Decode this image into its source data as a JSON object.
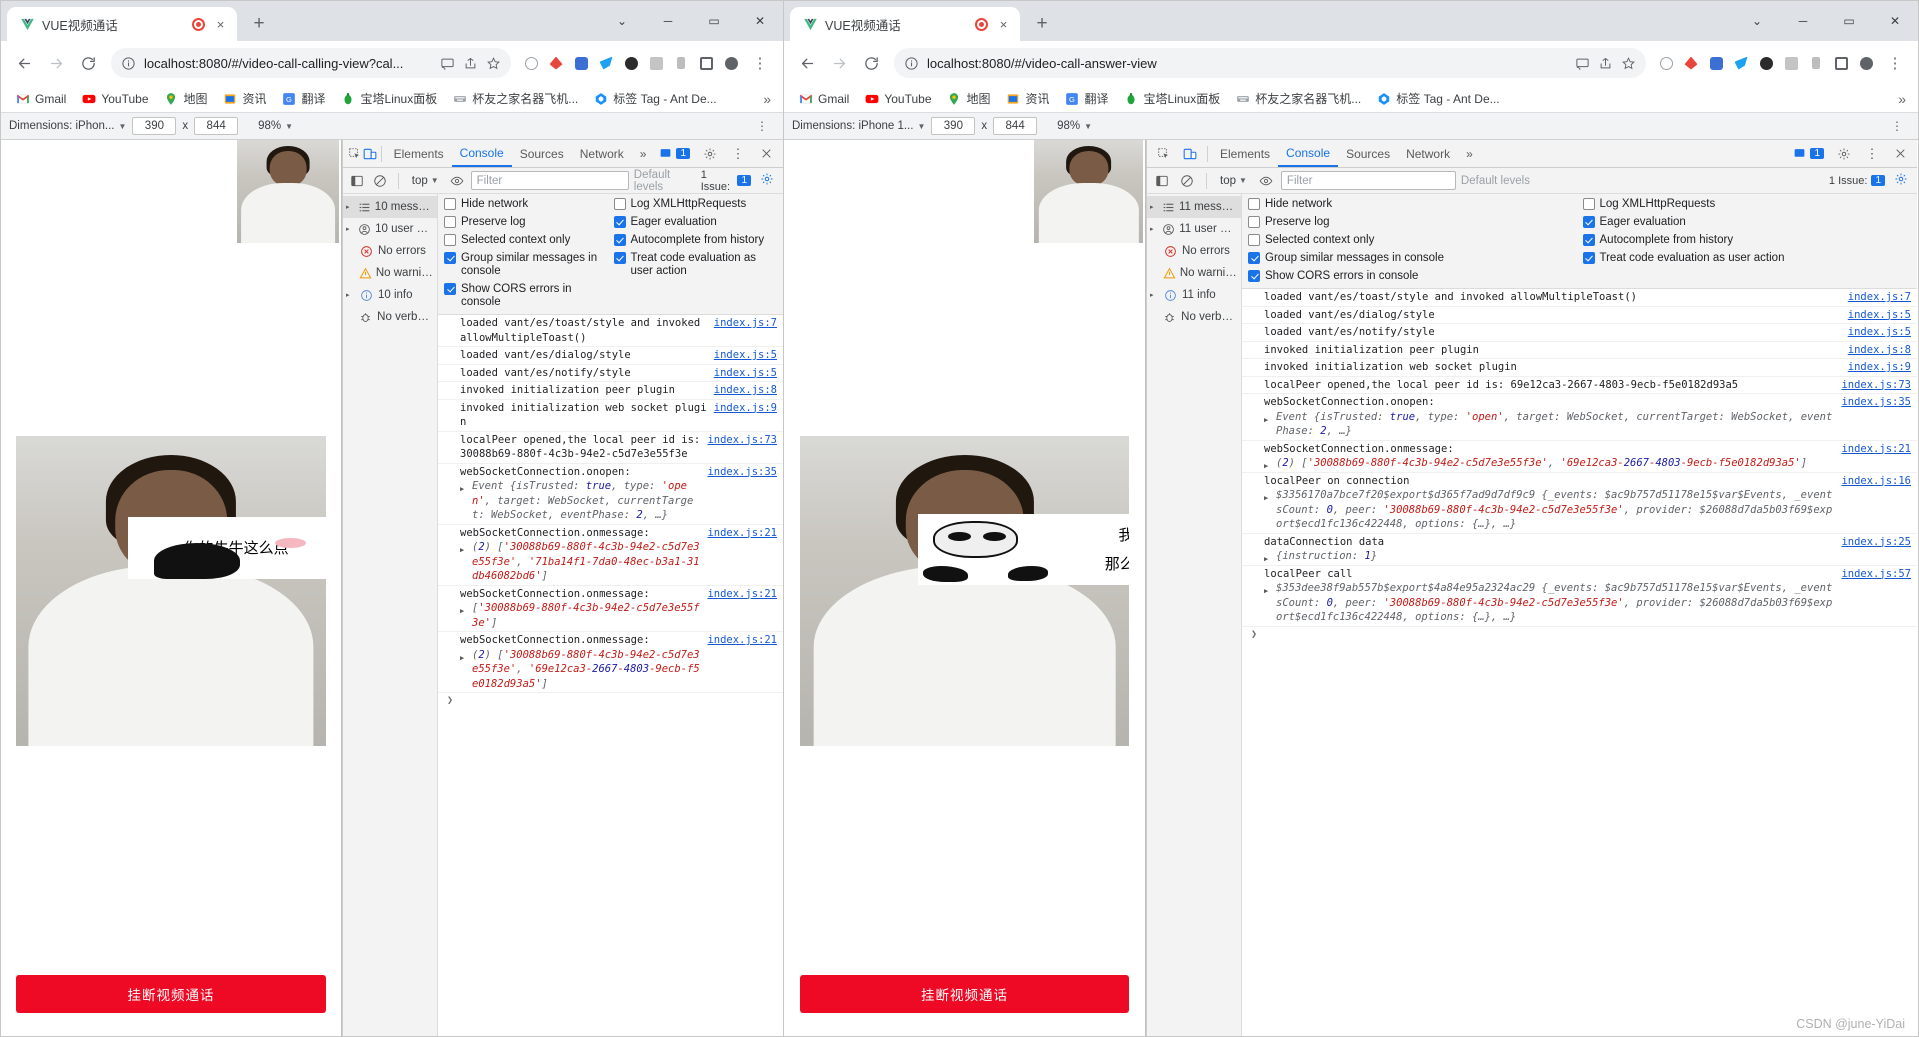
{
  "watermark": "CSDN @june-YiDai",
  "windows": [
    {
      "id": "left",
      "tab": {
        "title": "VUE视频通话",
        "favicon": "vue-logo-icon",
        "recording": "record-dot-icon",
        "close": "×"
      },
      "window_controls": {
        "minimize": "─",
        "maximize": "▭",
        "close": "✕",
        "expand": "⌄"
      },
      "newtab_label": "+",
      "toolbar": {
        "back": "←",
        "forward": "→",
        "reload": "⟳",
        "site_info": "ⓘ",
        "url": "localhost:8080/#/video-call-calling-view?cal...",
        "cast": "▭",
        "share": "↗",
        "bookmark_star": "☆",
        "extensions": [
          "ext-gray-circle",
          "ext-red-drop",
          "ext-blue-square",
          "ext-blue-bird",
          "ext-dark-circle",
          "ext-gray-box",
          "ext-gray-bar",
          "ext-panel",
          "ext-avatar"
        ],
        "menu": "⋮"
      },
      "bookmarks": [
        {
          "label": "Gmail",
          "icon": "gmail-icon"
        },
        {
          "label": "YouTube",
          "icon": "youtube-icon"
        },
        {
          "label": "地图",
          "icon": "maps-icon"
        },
        {
          "label": "资讯",
          "icon": "news-icon"
        },
        {
          "label": "翻译",
          "icon": "translate-icon"
        },
        {
          "label": "宝塔Linux面板",
          "icon": "bt-panel-icon"
        },
        {
          "label": "杯友之家名器飞机...",
          "icon": "keyboard-icon"
        },
        {
          "label": "标签 Tag - Ant De...",
          "icon": "ant-design-icon"
        }
      ],
      "bookmarks_overflow": "»",
      "device_bar": {
        "dimensions_label": "Dimensions: iPhon...",
        "width": "390",
        "x": "x",
        "height": "844",
        "zoom": "98%",
        "more": "⋮"
      },
      "page": {
        "meme_text_lines": [
          "你的牛牛这么点"
        ],
        "hangup_label": "挂断视频通话"
      },
      "devtools": {
        "tabs": [
          "Elements",
          "Console",
          "Sources",
          "Network"
        ],
        "active_tab": "Console",
        "overflow": "»",
        "inspect_icon": "inspect-icon",
        "device_toggle_icon": "device-toolbar-icon",
        "issues_count": "1",
        "settings_icon": "gear-icon",
        "close_icon": "close-icon",
        "filter_bar": {
          "sidebar_toggle": "sidebar-toggle-icon",
          "clear_icon": "clear-console-icon",
          "context": "top",
          "eye_icon": "live-expression-icon",
          "filter_placeholder": "Filter",
          "levels": "Default levels",
          "issues_label": "1 Issue:",
          "issues_count": "1",
          "settings_icon": "console-settings-icon"
        },
        "sidebar": [
          {
            "label": "10 messages",
            "icon": "list-icon",
            "arrow": "▸",
            "selected": true
          },
          {
            "label": "10 user me...",
            "icon": "user-icon",
            "arrow": "▸",
            "selected": false
          },
          {
            "label": "No errors",
            "icon": "error-icon",
            "arrow": "",
            "selected": false
          },
          {
            "label": "No warnings",
            "icon": "warning-icon",
            "arrow": "",
            "selected": false
          },
          {
            "label": "10 info",
            "icon": "info-icon",
            "arrow": "▸",
            "selected": false
          },
          {
            "label": "No verbose",
            "icon": "verbose-icon",
            "arrow": "",
            "selected": false
          }
        ],
        "settings": {
          "col1": [
            {
              "label": "Hide network",
              "checked": false
            },
            {
              "label": "Preserve log",
              "checked": false
            },
            {
              "label": "Selected context only",
              "checked": false
            },
            {
              "label": "Group similar messages in console",
              "checked": true
            },
            {
              "label": "Show CORS errors in console",
              "checked": true
            }
          ],
          "col2": [
            {
              "label": "Log XMLHttpRequests",
              "checked": false
            },
            {
              "label": "Eager evaluation",
              "checked": true
            },
            {
              "label": "Autocomplete from history",
              "checked": true
            },
            {
              "label": "Treat code evaluation as user action",
              "checked": true
            }
          ]
        },
        "logs": [
          {
            "text": "loaded vant/es/toast/style and invoked allowMultipleToast()",
            "src": "index.js:7",
            "arrow": false
          },
          {
            "text": "loaded vant/es/dialog/style",
            "src": "index.js:5",
            "arrow": false
          },
          {
            "text": "loaded vant/es/notify/style",
            "src": "index.js:5",
            "arrow": false
          },
          {
            "text": "invoked initialization peer plugin",
            "src": "index.js:8",
            "arrow": false
          },
          {
            "text": "invoked initialization web socket plugin",
            "src": "index.js:9",
            "arrow": false
          },
          {
            "text": "localPeer opened,the local peer id is: 30088b69-880f-4c3b-94e2-c5d7e3e55f3e",
            "src": "index.js:73",
            "arrow": false
          },
          {
            "text": "webSocketConnection.onopen:",
            "src": "index.js:35",
            "arrow": false,
            "detail": "Event {isTrusted: true, type: 'open', target: WebSocket, currentTarget: WebSocket, eventPhase: 2, …}",
            "detail_arrow": true
          },
          {
            "text": "webSocketConnection.onmessage:",
            "src": "index.js:21",
            "arrow": false,
            "detail": "(2) ['30088b69-880f-4c3b-94e2-c5d7e3e55f3e', '71ba14f1-7da0-48ec-b3a1-31db46082bd6']",
            "detail_arrow": true
          },
          {
            "text": "webSocketConnection.onmessage:",
            "src": "index.js:21",
            "arrow": false,
            "detail": "['30088b69-880f-4c3b-94e2-c5d7e3e55f3e']",
            "detail_arrow": true
          },
          {
            "text": "webSocketConnection.onmessage:",
            "src": "index.js:21",
            "arrow": false,
            "detail": "(2) ['30088b69-880f-4c3b-94e2-c5d7e3e55f3e', '69e12ca3-2667-4803-9ecb-f5e0182d93a5']",
            "detail_arrow": true
          }
        ]
      }
    },
    {
      "id": "right",
      "tab": {
        "title": "VUE视频通话",
        "favicon": "vue-logo-icon",
        "recording": "record-dot-icon",
        "close": "×"
      },
      "window_controls": {
        "minimize": "─",
        "maximize": "▭",
        "close": "✕",
        "expand": "⌄"
      },
      "newtab_label": "+",
      "toolbar": {
        "back": "←",
        "forward": "→",
        "reload": "⟳",
        "site_info": "ⓘ",
        "url": "localhost:8080/#/video-call-answer-view",
        "cast": "▭",
        "share": "↗",
        "bookmark_star": "☆",
        "extensions": [
          "ext-gray-circle",
          "ext-red-drop",
          "ext-blue-square",
          "ext-blue-bird",
          "ext-dark-circle",
          "ext-gray-box",
          "ext-gray-bar",
          "ext-panel",
          "ext-avatar"
        ],
        "menu": "⋮"
      },
      "bookmarks": [
        {
          "label": "Gmail",
          "icon": "gmail-icon"
        },
        {
          "label": "YouTube",
          "icon": "youtube-icon"
        },
        {
          "label": "地图",
          "icon": "maps-icon"
        },
        {
          "label": "资讯",
          "icon": "news-icon"
        },
        {
          "label": "翻译",
          "icon": "translate-icon"
        },
        {
          "label": "宝塔Linux面板",
          "icon": "bt-panel-icon"
        },
        {
          "label": "杯友之家名器飞机...",
          "icon": "keyboard-icon"
        },
        {
          "label": "标签 Tag - Ant De...",
          "icon": "ant-design-icon"
        }
      ],
      "bookmarks_overflow": "»",
      "device_bar": {
        "dimensions_label": "Dimensions: iPhone 1...",
        "width": "390",
        "x": "x",
        "height": "844",
        "zoom": "98%",
        "more": "⋮"
      },
      "page": {
        "meme_text_lines": [
          "我的",
          "那么大~"
        ],
        "hangup_label": "挂断视频通话"
      },
      "devtools": {
        "tabs": [
          "Elements",
          "Console",
          "Sources",
          "Network"
        ],
        "active_tab": "Console",
        "overflow": "»",
        "inspect_icon": "inspect-icon",
        "device_toggle_icon": "device-toolbar-icon",
        "issues_count": "1",
        "settings_icon": "gear-icon",
        "close_icon": "close-icon",
        "filter_bar": {
          "sidebar_toggle": "sidebar-toggle-icon",
          "clear_icon": "clear-console-icon",
          "context": "top",
          "eye_icon": "live-expression-icon",
          "filter_placeholder": "Filter",
          "levels": "Default levels",
          "issues_label": "1 Issue:",
          "issues_count": "1",
          "settings_icon": "console-settings-icon"
        },
        "sidebar": [
          {
            "label": "11 messages",
            "icon": "list-icon",
            "arrow": "▸",
            "selected": true
          },
          {
            "label": "11 user me...",
            "icon": "user-icon",
            "arrow": "▸",
            "selected": false
          },
          {
            "label": "No errors",
            "icon": "error-icon",
            "arrow": "",
            "selected": false
          },
          {
            "label": "No warnings",
            "icon": "warning-icon",
            "arrow": "",
            "selected": false
          },
          {
            "label": "11 info",
            "icon": "info-icon",
            "arrow": "▸",
            "selected": false
          },
          {
            "label": "No verbose",
            "icon": "verbose-icon",
            "arrow": "",
            "selected": false
          }
        ],
        "settings": {
          "col1": [
            {
              "label": "Hide network",
              "checked": false
            },
            {
              "label": "Preserve log",
              "checked": false
            },
            {
              "label": "Selected context only",
              "checked": false
            },
            {
              "label": "Group similar messages in console",
              "checked": true
            },
            {
              "label": "Show CORS errors in console",
              "checked": true
            }
          ],
          "col2": [
            {
              "label": "Log XMLHttpRequests",
              "checked": false
            },
            {
              "label": "Eager evaluation",
              "checked": true
            },
            {
              "label": "Autocomplete from history",
              "checked": true
            },
            {
              "label": "Treat code evaluation as user action",
              "checked": true
            }
          ]
        },
        "logs": [
          {
            "text": "loaded vant/es/toast/style and invoked allowMultipleToast()",
            "src": "index.js:7",
            "arrow": false
          },
          {
            "text": "loaded vant/es/dialog/style",
            "src": "index.js:5",
            "arrow": false
          },
          {
            "text": "loaded vant/es/notify/style",
            "src": "index.js:5",
            "arrow": false
          },
          {
            "text": "invoked initialization peer plugin",
            "src": "index.js:8",
            "arrow": false
          },
          {
            "text": "invoked initialization web socket plugin",
            "src": "index.js:9",
            "arrow": false
          },
          {
            "text": "localPeer opened,the local peer id is: 69e12ca3-2667-4803-9ecb-f5e0182d93a5",
            "src": "index.js:73",
            "arrow": false
          },
          {
            "text": "webSocketConnection.onopen:",
            "src": "index.js:35",
            "arrow": false,
            "detail": "Event {isTrusted: true, type: 'open', target: WebSocket, currentTarget: WebSocket, eventPhase: 2, …}",
            "detail_arrow": true
          },
          {
            "text": "webSocketConnection.onmessage:",
            "src": "index.js:21",
            "arrow": false,
            "detail": "(2) ['30088b69-880f-4c3b-94e2-c5d7e3e55f3e', '69e12ca3-2667-4803-9ecb-f5e0182d93a5']",
            "detail_arrow": true
          },
          {
            "text": "localPeer on connection",
            "src": "index.js:16",
            "arrow": false,
            "detail": "$3356170a7bce7f20$export$d365f7ad9d7df9c9 {_events: $ac9b757d51178e15$var$Events, _eventsCount: 0, peer: '30088b69-880f-4c3b-94e2-c5d7e3e55f3e', provider: $26088d7da5b03f69$export$ecd1fc136c422448, options: {…}, …}",
            "detail_arrow": true
          },
          {
            "text": "dataConnection data",
            "src": "index.js:25",
            "arrow": false,
            "detail": "{instruction: 1}",
            "detail_arrow": true
          },
          {
            "text": "localPeer call",
            "src": "index.js:57",
            "arrow": false,
            "detail": "$353dee38f9ab557b$export$4a84e95a2324ac29 {_events: $ac9b757d51178e15$var$Events, _eventsCount: 0, peer: '30088b69-880f-4c3b-94e2-c5d7e3e55f3e', provider: $26088d7da5b03f69$export$ecd1fc136c422448, options: {…}, …}",
            "detail_arrow": true
          }
        ]
      }
    }
  ]
}
